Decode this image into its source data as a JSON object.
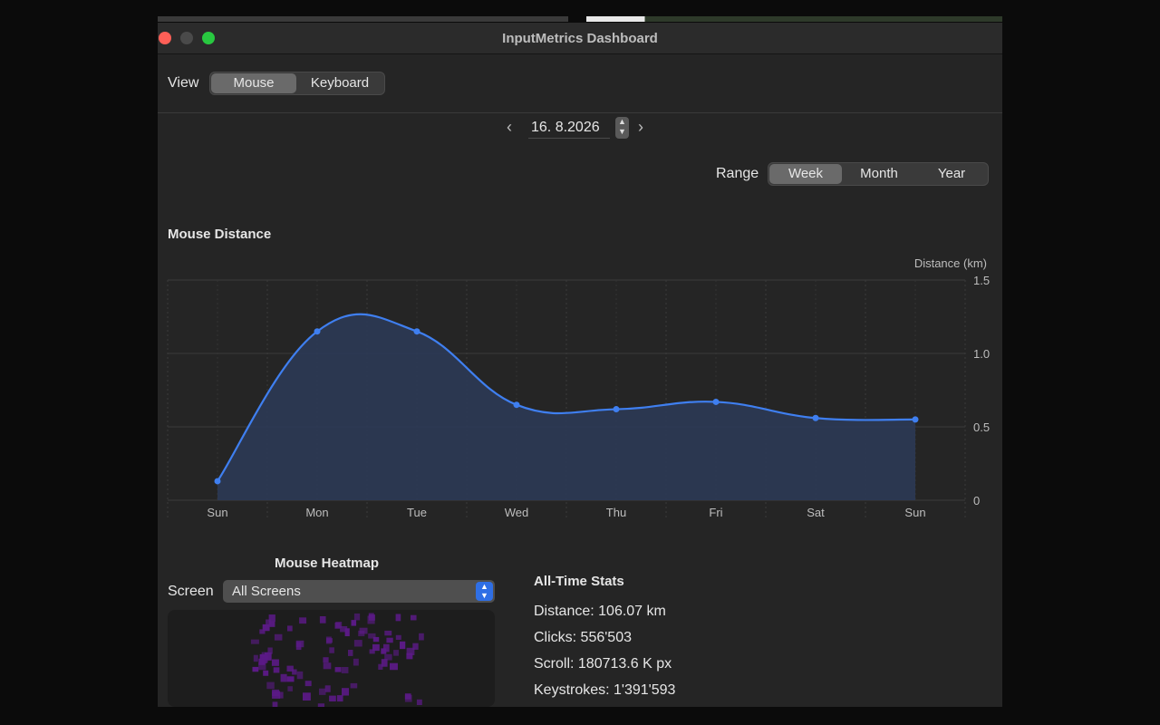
{
  "window": {
    "title": "InputMetrics Dashboard"
  },
  "toolbar": {
    "view_label": "View",
    "view_options": [
      "Mouse",
      "Keyboard"
    ],
    "view_selected": "Mouse"
  },
  "date_nav": {
    "prev_icon": "chevron-left-icon",
    "next_icon": "chevron-right-icon",
    "date_value": "16.  8.2026"
  },
  "range": {
    "label": "Range",
    "options": [
      "Week",
      "Month",
      "Year"
    ],
    "selected": "Week"
  },
  "mouse_distance": {
    "title": "Mouse Distance"
  },
  "chart_data": {
    "type": "area",
    "title": "Mouse Distance",
    "ylabel": "Distance (km)",
    "xlabel": "",
    "categories": [
      "Sun",
      "Mon",
      "Tue",
      "Wed",
      "Thu",
      "Fri",
      "Sat",
      "Sun"
    ],
    "series": [
      {
        "values": [
          0.13,
          1.15,
          1.15,
          0.65,
          0.62,
          0.67,
          0.56,
          0.55
        ]
      }
    ],
    "ylim": [
      0,
      1.5
    ],
    "yticks": [
      "0",
      "0.5",
      "1.0",
      "1.5"
    ],
    "grid": true,
    "line_color": "#3f7ff0",
    "fill_color": "#2c3a55"
  },
  "heatmap": {
    "title": "Mouse Heatmap",
    "screen_label": "Screen",
    "screen_selected": "All Screens",
    "dot_color": "#5b1a86"
  },
  "stats": {
    "title": "All-Time Stats",
    "distance": "Distance: 106.07 km",
    "clicks": "Clicks: 556'503",
    "scroll": "Scroll: 180713.6 K px",
    "keystrokes": "Keystrokes: 1'391'593"
  }
}
